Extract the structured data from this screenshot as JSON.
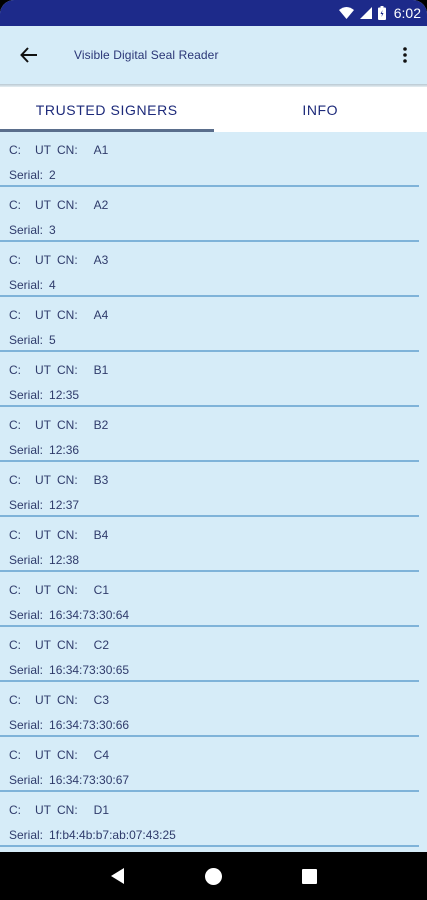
{
  "status_bar": {
    "time": "6:02"
  },
  "app_bar": {
    "title": "Visible Digital Seal Reader"
  },
  "tabs": [
    {
      "label": "TRUSTED SIGNERS",
      "active": true
    },
    {
      "label": "INFO",
      "active": false
    }
  ],
  "list": {
    "c_label": "C:",
    "c_value": "UT",
    "cn_label": "CN:",
    "serial_label": "Serial:",
    "items": [
      {
        "cn": "A1",
        "serial": "2"
      },
      {
        "cn": "A2",
        "serial": "3"
      },
      {
        "cn": "A3",
        "serial": "4"
      },
      {
        "cn": "A4",
        "serial": "5"
      },
      {
        "cn": "B1",
        "serial": "12:35"
      },
      {
        "cn": "B2",
        "serial": "12:36"
      },
      {
        "cn": "B3",
        "serial": "12:37"
      },
      {
        "cn": "B4",
        "serial": "12:38"
      },
      {
        "cn": "C1",
        "serial": "16:34:73:30:64"
      },
      {
        "cn": "C2",
        "serial": "16:34:73:30:65"
      },
      {
        "cn": "C3",
        "serial": "16:34:73:30:66"
      },
      {
        "cn": "C4",
        "serial": "16:34:73:30:67"
      },
      {
        "cn": "D1",
        "serial": "1f:b4:4b:b7:ab:07:43:25"
      }
    ]
  },
  "colors": {
    "status_bar": "#1d2a8a",
    "background": "#d6ecf8",
    "text": "#2f3b6b",
    "divider": "#7fb3d9"
  },
  "icons": {
    "wifi": "wifi-icon",
    "signal": "signal-icon",
    "battery": "battery-icon",
    "back": "arrow-back-icon",
    "overflow": "more-vert-icon",
    "nav_back": "nav-back-icon",
    "nav_home": "nav-home-icon",
    "nav_recents": "nav-recents-icon"
  }
}
